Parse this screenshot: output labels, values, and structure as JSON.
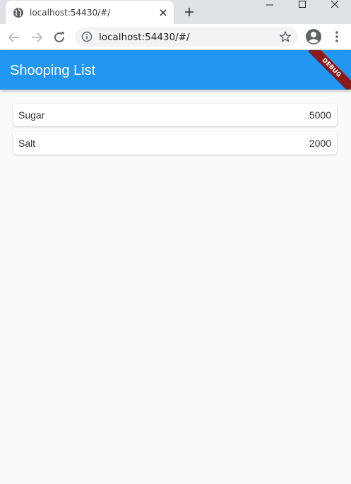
{
  "browser": {
    "tab_title": "localhost:54430/#/",
    "url": "localhost:54430/#/"
  },
  "app": {
    "title": "Shooping List",
    "debug_banner": "DEBUG",
    "appbar_color": "#2196f3"
  },
  "items": [
    {
      "name": "Sugar",
      "value": "5000"
    },
    {
      "name": "Salt",
      "value": "2000"
    }
  ]
}
